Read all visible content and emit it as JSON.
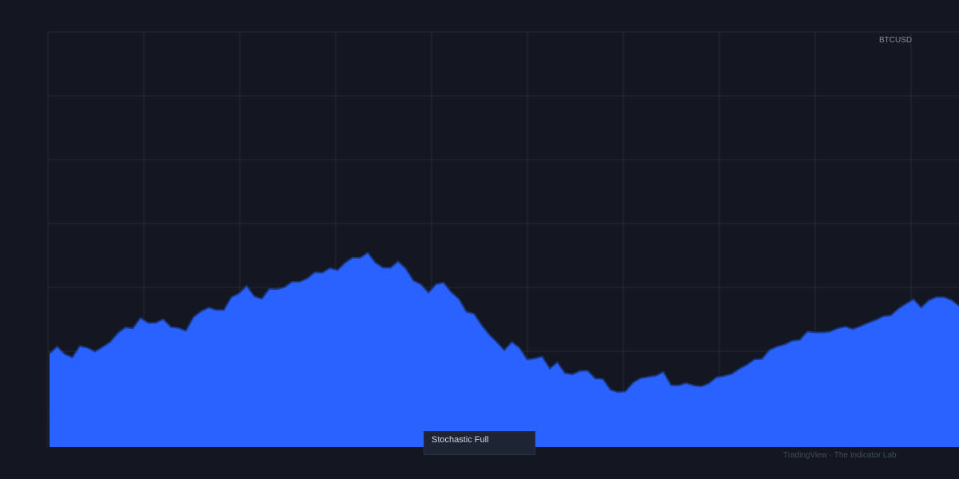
{
  "symbol": "BTCUSD",
  "indicator_label": "Stochastic Full",
  "watermark": "TradingView · The Indicator Lab",
  "colors": {
    "background": "#131722",
    "grid": "#232937",
    "area_fill": "#2962ff",
    "area_line": "#1e3a8a"
  },
  "chart_data": {
    "type": "area",
    "title": "",
    "xlabel": "",
    "ylabel": "",
    "ylim": [
      0,
      100
    ],
    "grid": true,
    "x_tick_labels": [],
    "y_tick_labels": [],
    "series": [
      {
        "values": [
          22.5,
          24.2,
          22.4,
          21.6,
          24.3,
          23.9,
          23.0,
          24.1,
          25.3,
          27.4,
          28.8,
          28.6,
          31.1,
          29.9,
          29.9,
          30.8,
          28.9,
          28.7,
          28.0,
          31.3,
          32.7,
          33.6,
          33.0,
          33.0,
          36.1,
          37.0,
          38.8,
          36.3,
          35.7,
          38.1,
          38.0,
          38.5,
          39.8,
          39.8,
          40.6,
          42.1,
          42.0,
          43.1,
          42.6,
          44.4,
          45.6,
          45.6,
          46.8,
          44.4,
          43.2,
          43.2,
          44.7,
          43.0,
          40.1,
          39.2,
          37.2,
          39.2,
          39.6,
          37.3,
          35.7,
          32.6,
          32.1,
          29.4,
          27.1,
          25.3,
          23.3,
          25.3,
          23.9,
          21.1,
          21.3,
          21.8,
          18.9,
          20.4,
          17.8,
          17.5,
          18.3,
          18.4,
          16.5,
          16.4,
          13.8,
          13.2,
          13.4,
          15.5,
          16.6,
          16.9,
          17.2,
          18.1,
          14.9,
          14.8,
          15.4,
          14.8,
          14.6,
          15.3,
          16.8,
          17.1,
          17.6,
          18.8,
          19.8,
          21.1,
          21.2,
          23.4,
          24.2,
          24.7,
          25.6,
          25.8,
          27.8,
          27.6,
          27.6,
          27.8,
          28.6,
          29.0,
          28.4,
          29.1,
          29.9,
          30.6,
          31.5,
          31.7,
          33.3,
          34.5,
          35.6,
          33.6,
          35.3,
          36.1,
          36.1,
          35.4,
          34.0
        ]
      }
    ]
  }
}
